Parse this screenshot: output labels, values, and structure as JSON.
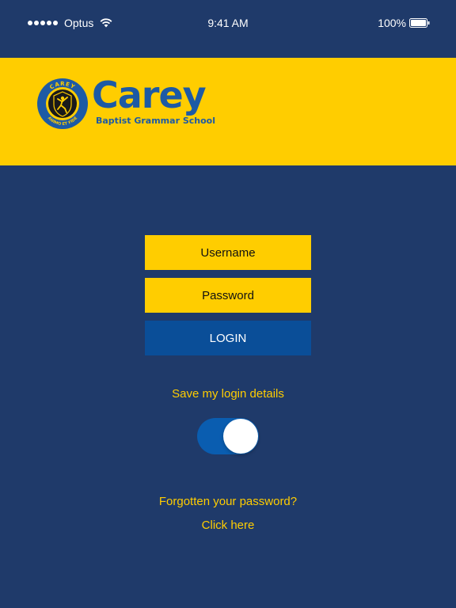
{
  "status_bar": {
    "carrier": "Optus",
    "time": "9:41 AM",
    "battery": "100%",
    "icons": [
      "signal-dots-icon",
      "wifi-icon",
      "battery-icon"
    ]
  },
  "header": {
    "logo_wordmark": "Carey",
    "logo_tagline": "Baptist Grammar School",
    "seal_top_text": "CAREY",
    "seal_bottom_text": "ANIMO ET FIDE",
    "background_color": "#ffcd00",
    "brand_color": "#1d5aa5"
  },
  "form": {
    "username_placeholder": "Username",
    "password_placeholder": "Password",
    "login_label": "LOGIN",
    "login_color": "#0a4e98"
  },
  "save_login": {
    "label": "Save my login details",
    "toggle_on": true
  },
  "forgot": {
    "text": "Forgotten your password?",
    "link": "Click here"
  },
  "colors": {
    "background": "#1f3a6a",
    "accent": "#ffcd00",
    "toggle_track": "#0a5db0"
  }
}
